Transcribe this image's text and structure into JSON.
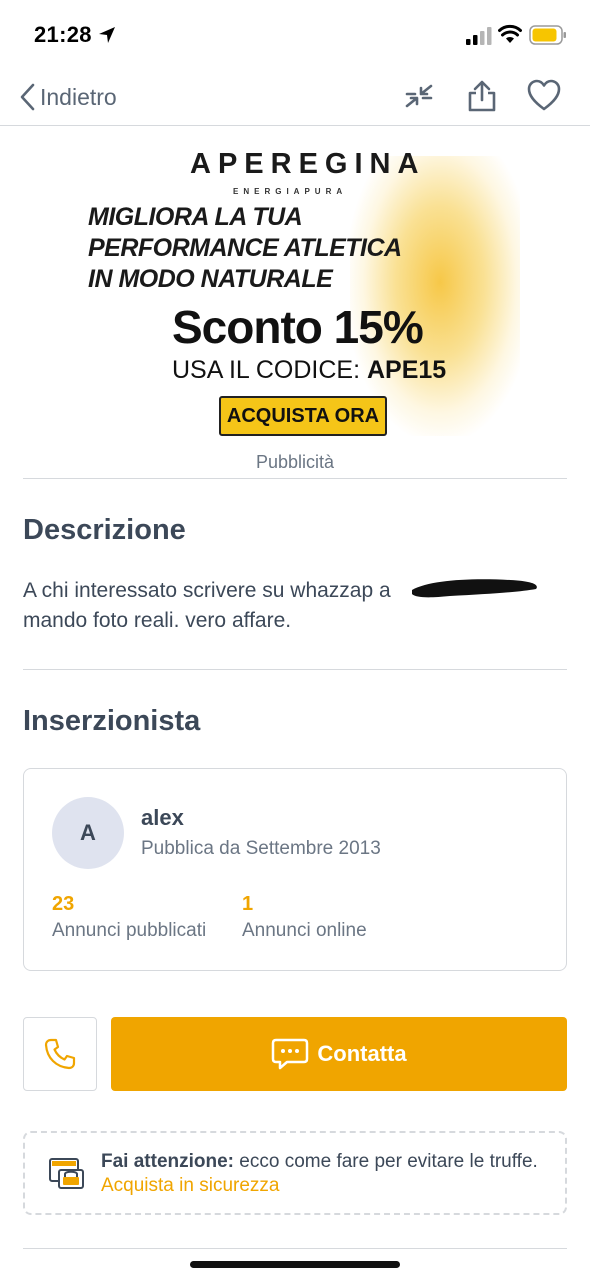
{
  "status_bar": {
    "time": "21:28"
  },
  "nav": {
    "back_label": "Indietro"
  },
  "ad": {
    "logo": "APEREGINA",
    "logo_sub": "ENERGIAPURA",
    "headline": [
      "MIGLIORA LA TUA",
      "PERFORMANCE ATLETICA",
      "IN MODO NATURALE"
    ],
    "discount": "Sconto 15%",
    "code_prefix": "USA IL CODICE:",
    "code": "APE15",
    "cta": "ACQUISTA ORA",
    "label": "Pubblicità"
  },
  "description": {
    "title": "Descrizione",
    "line1": "A chi interessato scrivere su whazzap a",
    "line2": " mando foto reali. vero affare."
  },
  "seller": {
    "section_title": "Inserzionista",
    "avatar_initial": "A",
    "name": "alex",
    "since": "Pubblica da Settembre 2013",
    "stats": [
      {
        "value": "23",
        "label": "Annunci pubblicati"
      },
      {
        "value": "1",
        "label": "Annunci online"
      }
    ]
  },
  "actions": {
    "contact_label": "Contatta"
  },
  "warning": {
    "bold": "Fai attenzione:",
    "text": " ecco come fare per evitare le truffe.",
    "link": "Acquista in sicurezza"
  },
  "colors": {
    "accent": "#f0a500",
    "text": "#3c4858",
    "muted": "#6b7684",
    "border": "#d6d9dd"
  }
}
